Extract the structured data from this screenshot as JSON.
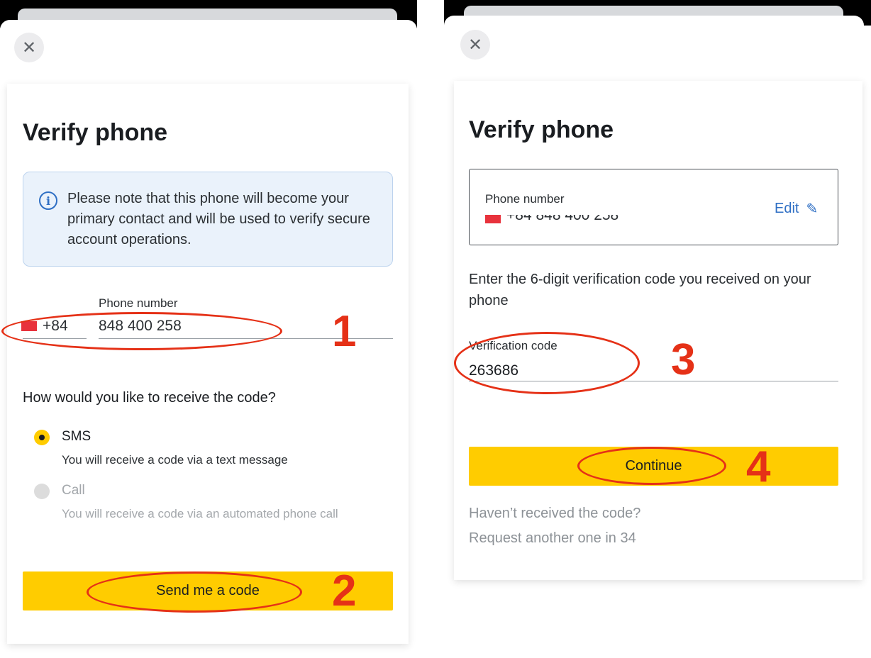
{
  "left": {
    "title": "Verify phone",
    "info": "Please note that this phone will become your primary contact and will be used to verify secure account operations.",
    "phone_label": "Phone number",
    "country_code": "+84",
    "phone_number": "848 400 258",
    "question": "How would you like to receive the code?",
    "options": [
      {
        "label": "SMS",
        "desc": "You will receive a code via a text message",
        "selected": true
      },
      {
        "label": "Call",
        "desc": "You will receive a code via an automated phone call",
        "selected": false
      }
    ],
    "send_button": "Send me a code",
    "annotations": [
      "1",
      "2"
    ]
  },
  "right": {
    "title": "Verify phone",
    "phone_label": "Phone number",
    "phone_value": "+84 848 400 258",
    "edit_label": "Edit",
    "instruction": "Enter the 6-digit verification code you received on your phone",
    "code_label": "Verification code",
    "code_value": "263686",
    "continue_button": "Continue",
    "not_received": "Haven’t received the code?",
    "request_again": "Request another one in 34",
    "annotations": [
      "3",
      "4"
    ]
  },
  "icons": {
    "close": "close-icon",
    "info": "info-icon",
    "edit": "pencil-icon",
    "flag": "vietnam-flag-icon"
  },
  "colors": {
    "accent_yellow": "#ffcc00",
    "link_blue": "#2f6fc4",
    "info_bg": "#eaf2fb",
    "annotation_red": "#e53117",
    "muted_text": "#8d9297"
  }
}
